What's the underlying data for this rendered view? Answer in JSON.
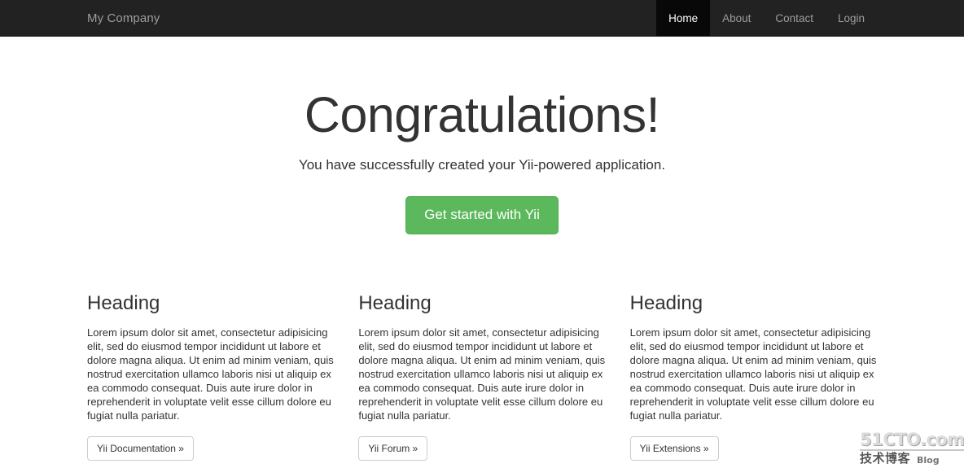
{
  "navbar": {
    "brand": "My Company",
    "background_color": "#222222",
    "active_background_color": "#080808",
    "link_color": "#9d9d9d",
    "items": [
      {
        "label": "Home",
        "active": true
      },
      {
        "label": "About",
        "active": false
      },
      {
        "label": "Contact",
        "active": false
      },
      {
        "label": "Login",
        "active": false
      }
    ]
  },
  "hero": {
    "title": "Congratulations!",
    "lead": "You have successfully created your Yii-powered application.",
    "cta_label": "Get started with Yii",
    "cta_color": "#5cb85c"
  },
  "columns": [
    {
      "heading": "Heading",
      "body": "Lorem ipsum dolor sit amet, consectetur adipisicing elit, sed do eiusmod tempor incididunt ut labore et dolore magna aliqua. Ut enim ad minim veniam, quis nostrud exercitation ullamco laboris nisi ut aliquip ex ea commodo consequat. Duis aute irure dolor in reprehenderit in voluptate velit esse cillum dolore eu fugiat nulla pariatur.",
      "button_label": "Yii Documentation »"
    },
    {
      "heading": "Heading",
      "body": "Lorem ipsum dolor sit amet, consectetur adipisicing elit, sed do eiusmod tempor incididunt ut labore et dolore magna aliqua. Ut enim ad minim veniam, quis nostrud exercitation ullamco laboris nisi ut aliquip ex ea commodo consequat. Duis aute irure dolor in reprehenderit in voluptate velit esse cillum dolore eu fugiat nulla pariatur.",
      "button_label": "Yii Forum »"
    },
    {
      "heading": "Heading",
      "body": "Lorem ipsum dolor sit amet, consectetur adipisicing elit, sed do eiusmod tempor incididunt ut labore et dolore magna aliqua. Ut enim ad minim veniam, quis nostrud exercitation ullamco laboris nisi ut aliquip ex ea commodo consequat. Duis aute irure dolor in reprehenderit in voluptate velit esse cillum dolore eu fugiat nulla pariatur.",
      "button_label": "Yii Extensions »"
    }
  ],
  "watermark": {
    "primary": "51CTO.com",
    "secondary": "技术博客",
    "tertiary": "Blog"
  }
}
